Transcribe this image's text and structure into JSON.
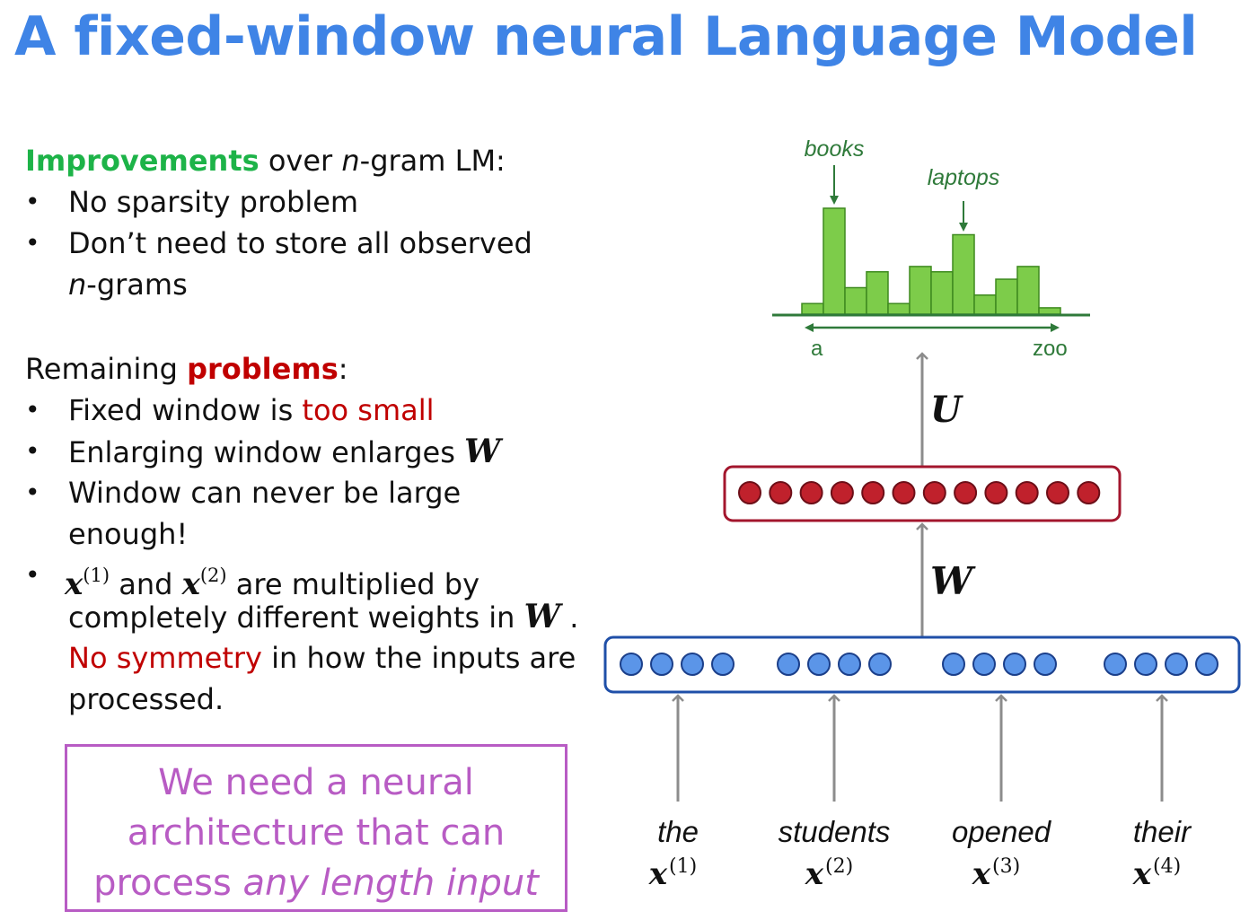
{
  "title": "A fixed-window neural Language Model",
  "improvements": {
    "heading_word": "Improvements",
    "heading_rest_a": " over ",
    "heading_n": "n",
    "heading_rest_b": "-gram LM:",
    "bullet1": "No sparsity problem",
    "bullet2_line1": "Don’t need to store all observed",
    "bullet2_n": "n",
    "bullet2_line2": "-grams"
  },
  "problems": {
    "heading_a": "Remaining ",
    "heading_word": "problems",
    "heading_b": ":",
    "b1_a": "Fixed window is ",
    "b1_red": "too small",
    "b2_a": "Enlarging window enlarges ",
    "b2_math": "W",
    "b3_line1": "Window can never be large",
    "b3_line2": "enough!",
    "b4_x": "x",
    "b4_sup1": "(1)",
    "b4_and": " and ",
    "b4_sup2": "(2)",
    "b4_rest": " are multiplied by",
    "b4_line2_a": "completely different weights in ",
    "b4_line2_math": "W",
    "b4_line2_b": " .",
    "b4_line3_red": "No symmetry",
    "b4_line3_rest": " in how the inputs are",
    "b4_line4": "processed."
  },
  "bullet_char": "•",
  "callout": {
    "line1": "We need a neural",
    "line2": "architecture that can",
    "line3_a": "process ",
    "line3_em": "any length input"
  },
  "diagram": {
    "dist_labels": {
      "peak1": "books",
      "peak2": "laptops",
      "left": "a",
      "right": "zoo"
    },
    "U_label": "U",
    "W_label": "W",
    "hidden_units": 12,
    "input_groups": 4,
    "units_per_group": 4,
    "distribution": [
      0.1,
      1.0,
      0.25,
      0.4,
      0.1,
      0.45,
      0.4,
      0.75,
      0.18,
      0.33,
      0.45,
      0.06
    ],
    "words": [
      {
        "word": "the",
        "x": "x",
        "sup": "(1)"
      },
      {
        "word": "students",
        "x": "x",
        "sup": "(2)"
      },
      {
        "word": "opened",
        "x": "x",
        "sup": "(3)"
      },
      {
        "word": "their",
        "x": "x",
        "sup": "(4)"
      }
    ],
    "colors": {
      "bar_fill": "#7dcc4a",
      "bar_stroke": "#3e8a1f",
      "label_green": "#2f7a3a",
      "hidden_fill": "#c0212c",
      "hidden_box": "#a3162d",
      "input_fill": "#5b95e8",
      "input_box": "#1f4fa8",
      "arrow": "#8c8c8c"
    }
  }
}
